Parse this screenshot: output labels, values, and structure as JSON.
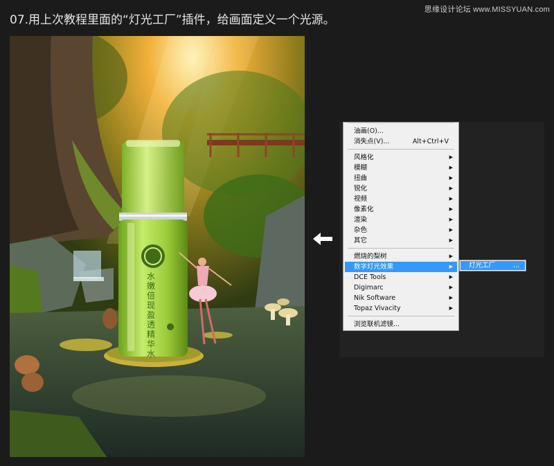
{
  "watermark": "思缘设计论坛 www.MISSYUAN.com",
  "step_title": "07.用上次教程里面的“灯光工厂”插件，给画面定义一个光源。",
  "bottle_label": "水嫩倍现盈透精华水",
  "colors": {
    "background": "#1b1b1b",
    "menu_bg": "#f0f0f0",
    "menu_highlight": "#3399ff",
    "bottle": "#9ccc3a"
  },
  "menu": {
    "top_items": [
      {
        "label": "油画(O)...",
        "shortcut": ""
      },
      {
        "label": "消失点(V)...",
        "shortcut": "Alt+Ctrl+V"
      }
    ],
    "filter_groups": [
      "风格化",
      "模糊",
      "扭曲",
      "锐化",
      "视频",
      "像素化",
      "渲染",
      "杂色",
      "其它"
    ],
    "plugins": [
      {
        "label": "燃烧的梨树",
        "highlight": false
      },
      {
        "label": "数字灯光效果",
        "highlight": true
      },
      {
        "label": "DCE Tools",
        "highlight": false
      },
      {
        "label": "Digimarc",
        "highlight": false
      },
      {
        "label": "Nik Software",
        "highlight": false
      },
      {
        "label": "Topaz Vivacity",
        "highlight": false
      }
    ],
    "browse": "浏览联机滤镜..."
  },
  "submenu": {
    "label": "灯光工厂",
    "ellipsis": "..."
  },
  "icons": [
    "left-arrow-icon",
    "chevron-right-icon"
  ]
}
